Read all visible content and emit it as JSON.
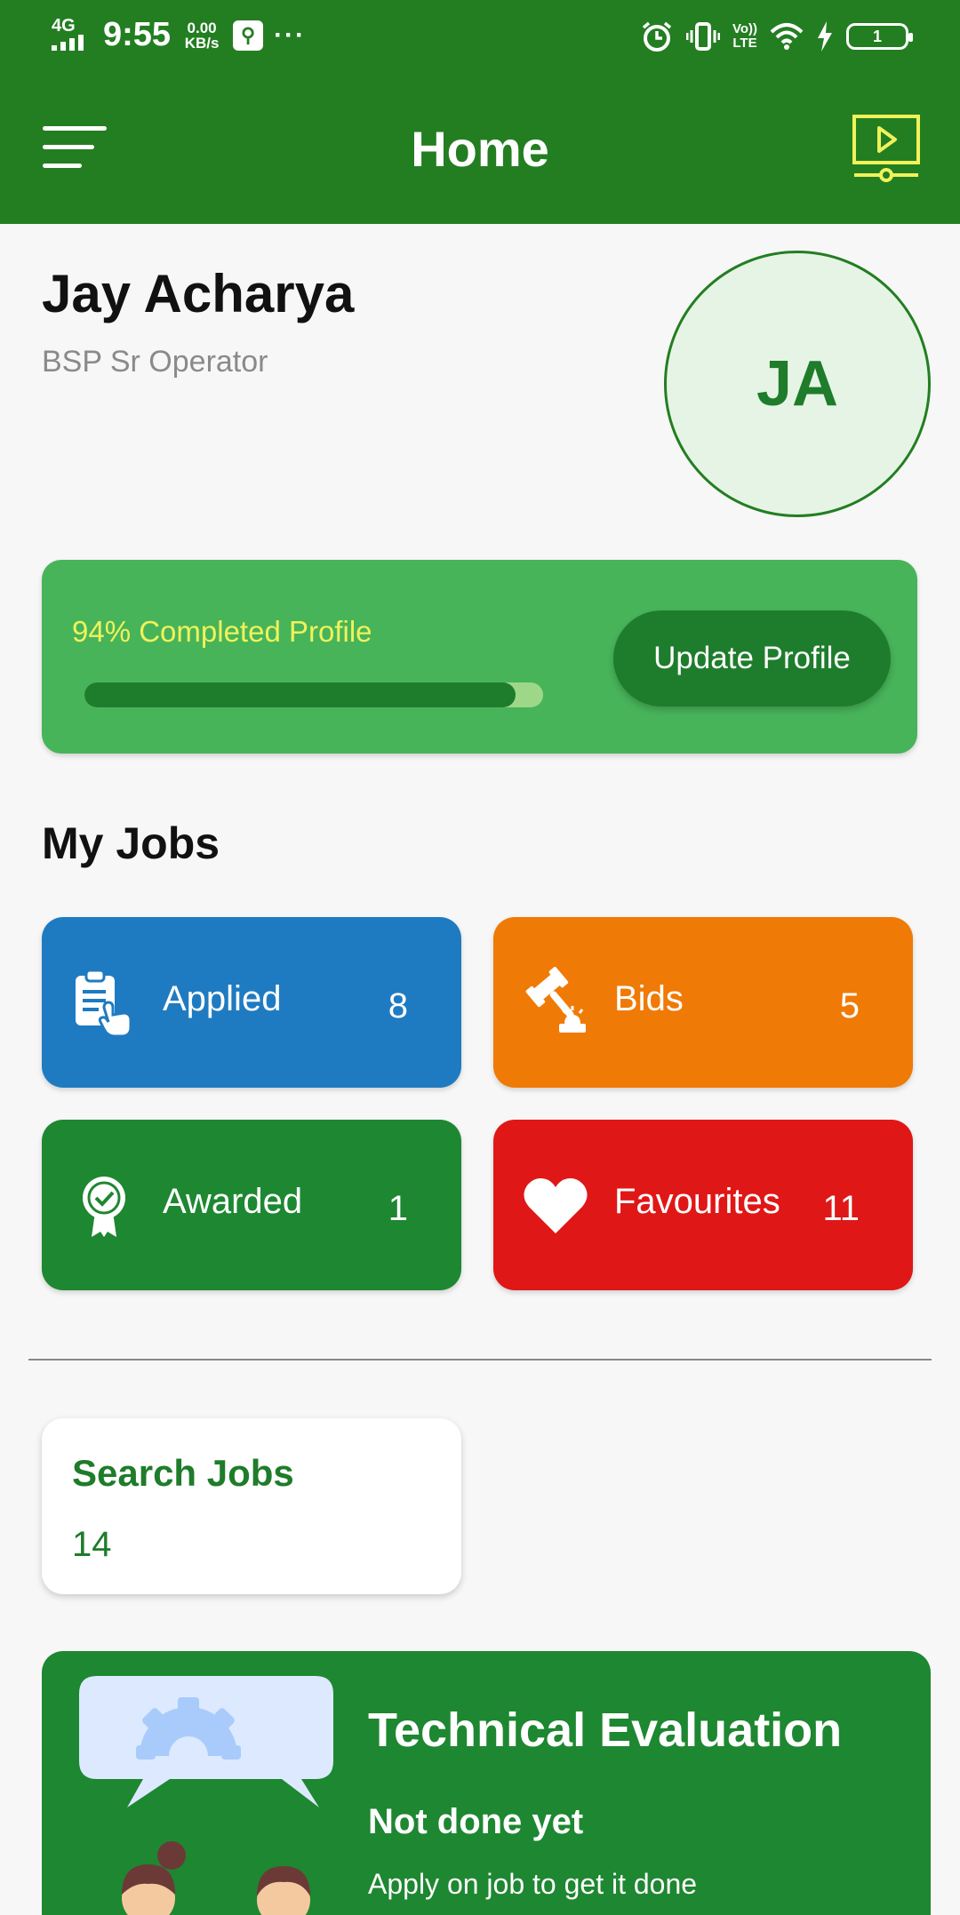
{
  "status_bar": {
    "network": "4G",
    "time": "9:55",
    "speed_value": "0.00",
    "speed_unit": "KB/s",
    "more": "···",
    "volte_top": "Vo))",
    "volte_bottom": "LTE",
    "battery": "1"
  },
  "appbar": {
    "title": "Home",
    "icons": [
      "menu-icon",
      "video-tutorial-icon"
    ]
  },
  "profile": {
    "name": "Jay Acharya",
    "role": "BSP Sr Operator",
    "initials": "JA"
  },
  "completion": {
    "label": "94% Completed Profile",
    "percent": 94,
    "button_label": "Update Profile"
  },
  "my_jobs": {
    "title": "My Jobs",
    "tiles": [
      {
        "label": "Applied",
        "count": "8",
        "icon": "clipboard-hand-icon",
        "color": "#1f7bc1"
      },
      {
        "label": "Bids",
        "count": "5",
        "icon": "gavel-icon",
        "color": "#f07a06"
      },
      {
        "label": "Awarded",
        "count": "1",
        "icon": "award-badge-icon",
        "color": "#1e8731"
      },
      {
        "label": "Favourites",
        "count": "11",
        "icon": "heart-icon",
        "color": "#e01717"
      }
    ]
  },
  "search_jobs": {
    "title": "Search Jobs",
    "count": "14"
  },
  "technical_evaluation": {
    "title": "Technical Evaluation",
    "status": "Not done yet",
    "description": "Apply on job to get it done"
  },
  "colors": {
    "primary": "#237e21",
    "profile_card": "#47b45a",
    "progress_fill": "#1e7d2c",
    "accent_yellow": "#f0f25a"
  }
}
